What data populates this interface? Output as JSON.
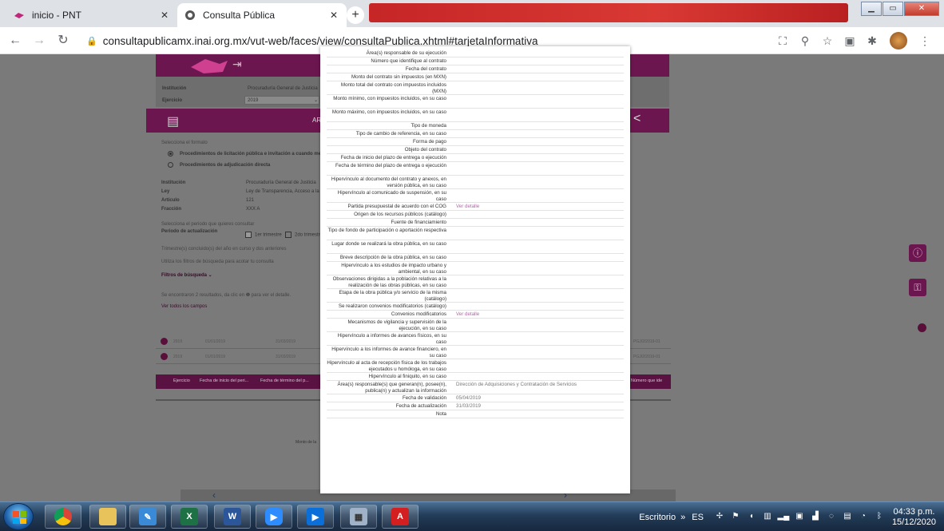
{
  "browser": {
    "tabs": [
      {
        "title": "inicio - PNT",
        "icon": "pnt-favicon"
      },
      {
        "title": "Consulta Pública",
        "icon": "globe-icon"
      }
    ],
    "url": "consultapublicamx.inai.org.mx/vut-web/faces/view/consultaPublica.xhtml#tarjetaInformativa"
  },
  "background": {
    "institucion_label": "Institución",
    "institucion_value": "Procuraduría General de Justicia",
    "ejercicio_label": "Ejercicio",
    "ejercicio_value": "2019",
    "bar_text": "AR",
    "selecciona_formato": "Selecciona el formato",
    "formato_option_1": "Procedimientos de licitación pública e invitación a cuando menos",
    "formato_option_2": "Procedimientos de adjudicación directa",
    "info_labels": [
      "Institución",
      "Ley",
      "Artículo",
      "Fracción"
    ],
    "info_values": [
      "Procuraduría General de Justicia",
      "Ley de Transparencia, Acceso a la",
      "121",
      "XXX A"
    ],
    "periodo_prompt": "Selecciona el periodo que quieres consultar",
    "periodo_label": "Periodo de actualización",
    "periodo_opt_1": "1er trimestre",
    "periodo_opt_2": "2do trimestre",
    "trimestres_text": "Trimestre(s) concluido(s) del año en curso y dos anteriores",
    "filtros_hint": "Utiliza los filtros de búsqueda para acotar tu consulta",
    "filtros_label": "Filtros de búsqueda ⌄",
    "resultados_text": "Se encontraron 2 resultados, da clic en ❶ para ver el detalle.",
    "ver_campos": "Ver todos los campos",
    "table_headers": [
      "Ejercicio",
      "Fecha de inicio del peri...",
      "Fecha de término del p...",
      "Número que ide"
    ],
    "table_rows": [
      [
        "2019",
        "01/01/2019",
        "31/03/2019",
        "PGJ/2/2019-01"
      ],
      [
        "2019",
        "01/01/2019",
        "31/03/2019",
        "PGJ/2/2019-01"
      ]
    ],
    "bottom_text": "Monto de la"
  },
  "modal": {
    "rows": [
      {
        "label": "Área(s) responsable de su ejecución",
        "value": ""
      },
      {
        "label": "Número que identifique al contrato",
        "value": ""
      },
      {
        "label": "Fecha del contrato",
        "value": ""
      },
      {
        "label": "Monto del contrato sin impuestos (en MXN)",
        "value": ""
      },
      {
        "label": "Monto total del contrato con impuestos incluidos (MXN)",
        "value": ""
      },
      {
        "label": "Monto mínimo, con impuestos incluidos, en su caso",
        "value": ""
      },
      {
        "label": "Monto máximo, con impuestos incluidos, en su caso",
        "value": ""
      },
      {
        "label": "Tipo de moneda",
        "value": ""
      },
      {
        "label": "Tipo de cambio de referencia, en su caso",
        "value": ""
      },
      {
        "label": "Forma de pago",
        "value": ""
      },
      {
        "label": "Objeto del contrato",
        "value": ""
      },
      {
        "label": "Fecha de inicio del plazo de entrega o ejecución",
        "value": ""
      },
      {
        "label": "Fecha de término del plazo de entrega o ejecución",
        "value": ""
      },
      {
        "label": "Hipervínculo al documento del contrato y anexos, en versión pública, en su caso",
        "value": ""
      },
      {
        "label": "Hipervínculo al comunicado de suspensión, en su caso",
        "value": ""
      },
      {
        "label": "Partida presupuestal de acuerdo con el COG",
        "value": "Ver detalle",
        "link": true
      },
      {
        "label": "Origen de los recursos públicos (catálogo)",
        "value": ""
      },
      {
        "label": "Fuente de financiamiento",
        "value": ""
      },
      {
        "label": "Tipo de fondo de participación o aportación respectiva",
        "value": ""
      },
      {
        "label": "Lugar donde se realizará la obra pública, en su caso",
        "value": ""
      },
      {
        "label": "Breve descripción de la obra pública, en su caso",
        "value": ""
      },
      {
        "label": "Hipervínculo a los estudios de impacto urbano y ambiental, en su caso",
        "value": ""
      },
      {
        "label": "Observaciones dirigidas a la población relativas a la realización de las obras públicas, en su caso",
        "value": ""
      },
      {
        "label": "Etapa de la obra pública y/o servicio de la misma (catálogo)",
        "value": ""
      },
      {
        "label": "Se realizaron convenios modificatorios (catálogo)",
        "value": ""
      },
      {
        "label": "Convenios modificatorios",
        "value": "Ver detalle",
        "link": true
      },
      {
        "label": "Mecanismos de vigilancia y supervisión de la ejecución, en su caso",
        "value": ""
      },
      {
        "label": "Hipervínculo a informes de avances físicos, en su caso",
        "value": ""
      },
      {
        "label": "Hipervínculo a los informes de avance financiero, en su caso",
        "value": ""
      },
      {
        "label": "Hipervínculo al acta de recepción física de los trabajos ejecutados u homóloga, en su caso",
        "value": ""
      },
      {
        "label": "Hipervínculo al finiquito, en su caso",
        "value": ""
      },
      {
        "label": "Área(s) responsable(s) que generan(n), posee(n), publica(n) y actualizan la información",
        "value": "Dirección de Adquisiciones y Contratación de Servicios"
      },
      {
        "label": "Fecha de validación",
        "value": "05/04/2019"
      },
      {
        "label": "Fecha de actualización",
        "value": "31/03/2019"
      },
      {
        "label": "Nota",
        "value": ""
      }
    ]
  },
  "taskbar": {
    "escritorio": "Escritorio",
    "lang": "ES",
    "time": "04:33 p.m.",
    "date": "15/12/2020",
    "chevron": "»"
  }
}
